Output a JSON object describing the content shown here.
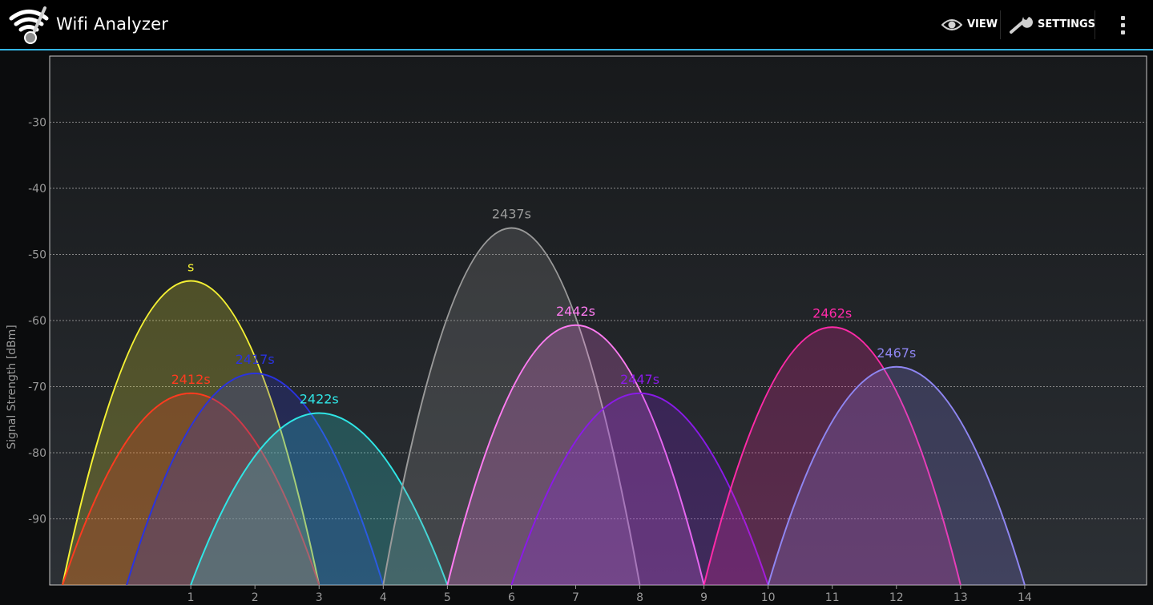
{
  "app": {
    "title": "Wifi Analyzer",
    "icon": "wifi-analyzer-icon"
  },
  "actions": {
    "view_label": "VIEW",
    "view_icon": "eye-icon",
    "settings_label": "SETTINGS",
    "settings_icon": "wrench-icon",
    "overflow_icon": "overflow-menu-icon"
  },
  "colors": {
    "accent": "#33b5e5",
    "background": "#1e2124"
  },
  "chart_data": {
    "type": "area",
    "ylabel": "Signal Strength [dBm]",
    "ylim": [
      -100,
      -20
    ],
    "yticks": [
      -30,
      -40,
      -50,
      -60,
      -70,
      -80,
      -90
    ],
    "xticks": [
      1,
      2,
      3,
      4,
      5,
      6,
      7,
      8,
      9,
      10,
      11,
      12,
      13,
      14
    ],
    "xlim": [
      -1.2,
      15.9
    ],
    "grid": true,
    "series": [
      {
        "name": "s",
        "channel": 1,
        "signal": -54,
        "color": "#f5f134"
      },
      {
        "name": "2412s",
        "channel": 1,
        "signal": -71,
        "color": "#ff3b1f"
      },
      {
        "name": "2417s",
        "channel": 2,
        "signal": -68,
        "color": "#2a33e0"
      },
      {
        "name": "2422s",
        "channel": 3,
        "signal": -74,
        "color": "#2fe6e6"
      },
      {
        "name": "2437s",
        "channel": 6,
        "signal": -46,
        "color": "#9a9a9a"
      },
      {
        "name": "2442s",
        "channel": 7,
        "signal": -60.7,
        "color": "#ff7cf2"
      },
      {
        "name": "2447s",
        "channel": 8,
        "signal": -71,
        "color": "#8a1ae8"
      },
      {
        "name": "2462s",
        "channel": 11,
        "signal": -61,
        "color": "#ff2aa8"
      },
      {
        "name": "2467s",
        "channel": 12,
        "signal": -67,
        "color": "#8f86f2"
      }
    ]
  }
}
